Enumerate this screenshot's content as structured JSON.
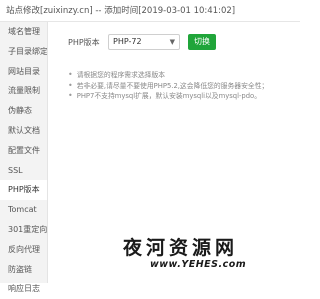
{
  "window": {
    "title": "站点修改[zuixinzy.cn] -- 添加时间[2019-03-01 10:41:02]"
  },
  "sidebar": {
    "items": [
      {
        "label": "域名管理"
      },
      {
        "label": "子目录绑定"
      },
      {
        "label": "网站目录"
      },
      {
        "label": "流量限制"
      },
      {
        "label": "伪静态"
      },
      {
        "label": "默认文档"
      },
      {
        "label": "配置文件"
      },
      {
        "label": "SSL"
      },
      {
        "label": "PHP版本"
      },
      {
        "label": "Tomcat"
      },
      {
        "label": "301重定向"
      },
      {
        "label": "反向代理"
      },
      {
        "label": "防盗链"
      },
      {
        "label": "响应日志"
      }
    ],
    "active_index": 8
  },
  "php": {
    "label": "PHP版本",
    "selected": "PHP-72",
    "switch_label": "切换"
  },
  "notes": [
    "请根据您的程序需求选择版本",
    "若非必要,请尽量不要使用PHP5.2,这会降低您的服务器安全性；",
    "PHP7不支持mysql扩展，默认安装mysqli以及mysql-pdo。"
  ],
  "watermark": {
    "text": "夜河资源网",
    "url": "www.YEHES.com"
  },
  "colors": {
    "accent": "#20a53a",
    "sidebar_bg": "#f3f3f3"
  }
}
